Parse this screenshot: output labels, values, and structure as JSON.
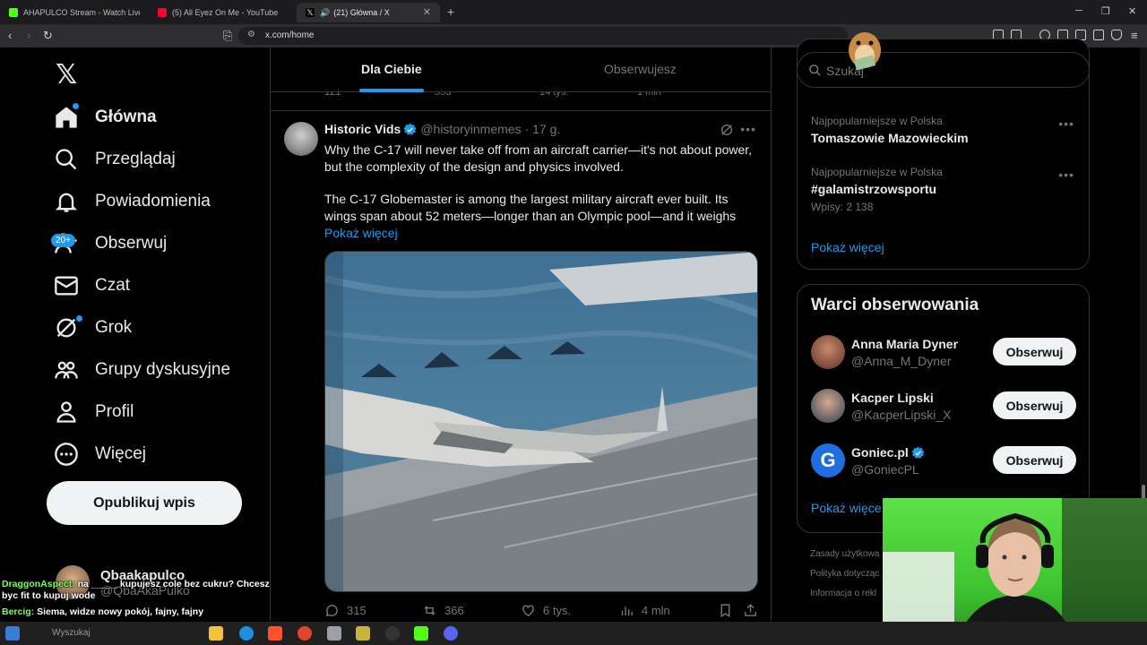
{
  "browser": {
    "tabs": [
      {
        "title": "AHAPULCO Stream - Watch Live on K",
        "favicon_color": "#53fc18"
      },
      {
        "title": "(5) All Eyez On Me - YouTube",
        "favicon_color": "#ff0033"
      },
      {
        "title": "(21) Główna / X",
        "favicon_color": "#ffffff",
        "active": true
      }
    ],
    "url": "x.com/home"
  },
  "nav": {
    "items": [
      {
        "label": "Główna",
        "icon": "home-icon"
      },
      {
        "label": "Przeglądaj",
        "icon": "search-icon"
      },
      {
        "label": "Powiadomienia",
        "icon": "bell-icon"
      },
      {
        "label": "Obserwuj",
        "icon": "add-person-icon"
      },
      {
        "label": "Czat",
        "icon": "mail-icon"
      },
      {
        "label": "Grok",
        "icon": "grok-icon"
      },
      {
        "label": "Grupy dyskusyjne",
        "icon": "communities-icon"
      },
      {
        "label": "Profil",
        "icon": "person-icon"
      },
      {
        "label": "Więcej",
        "icon": "more-circle-icon"
      }
    ],
    "notification_badge": "20+",
    "post_button": "Opublikuj wpis",
    "account": {
      "name": "Qbaakapulco",
      "handle": "@QbaAkaPulko"
    }
  },
  "feed": {
    "tabs": [
      "Dla Ciebie",
      "Obserwujesz"
    ],
    "prev_stats": {
      "replies": "121",
      "reposts": "553",
      "views": "14 tys.",
      "extra": "1 mln"
    },
    "tweet": {
      "name": "Historic Vids",
      "handle": "@historyinmemes",
      "time": "· 17 g.",
      "text1": "Why the C-17 will never take off from an aircraft carrier—it's not about power, but the complexity of the design and physics involved.",
      "text2": "The C-17 Globemaster is among the largest military aircraft ever built. Its wings span about 52 meters—longer than an Olympic pool—and it weighs",
      "show_more": "Pokaż więcej",
      "stats": {
        "replies": "315",
        "reposts": "366",
        "likes": "6 tys.",
        "views": "4 mln"
      }
    }
  },
  "right": {
    "search_placeholder": "Szukaj",
    "trends": [
      {
        "context": "Najpopularniejsze w Polska",
        "title": "Tomaszowie Mazowieckim",
        "count": ""
      },
      {
        "context": "Najpopularniejsze w Polska",
        "title": "#galamistrzowsportu",
        "count": "Wpisy: 2 138"
      }
    ],
    "show_more": "Pokaż więcej",
    "who_to_follow": {
      "title": "Warci obserwowania",
      "users": [
        {
          "name": "Anna Maria Dyner",
          "handle": "@Anna_M_Dyner",
          "button": "Obserwuj",
          "verified": false
        },
        {
          "name": "Kacper Lipski",
          "handle": "@KacperLipski_X",
          "button": "Obserwuj",
          "verified": false
        },
        {
          "name": "Goniec.pl",
          "handle": "@GoniecPL",
          "button": "Obserwuj",
          "verified": true
        }
      ],
      "show_more": "Pokaż więce"
    },
    "footer": [
      "Zasady użytkowa",
      "Polityka dotycząc",
      "Informacja o rekl"
    ]
  },
  "chat": [
    {
      "user": "DraggonAspect:",
      "message": "na _____ kupujesz cole bez cukru? Chcesz byc fit to kupuj wode"
    },
    {
      "user": "Bercig:",
      "message": "Siema, widze nowy pokój, fajny, fajny"
    }
  ],
  "taskbar": {
    "search_hint": "Wyszukaj"
  }
}
